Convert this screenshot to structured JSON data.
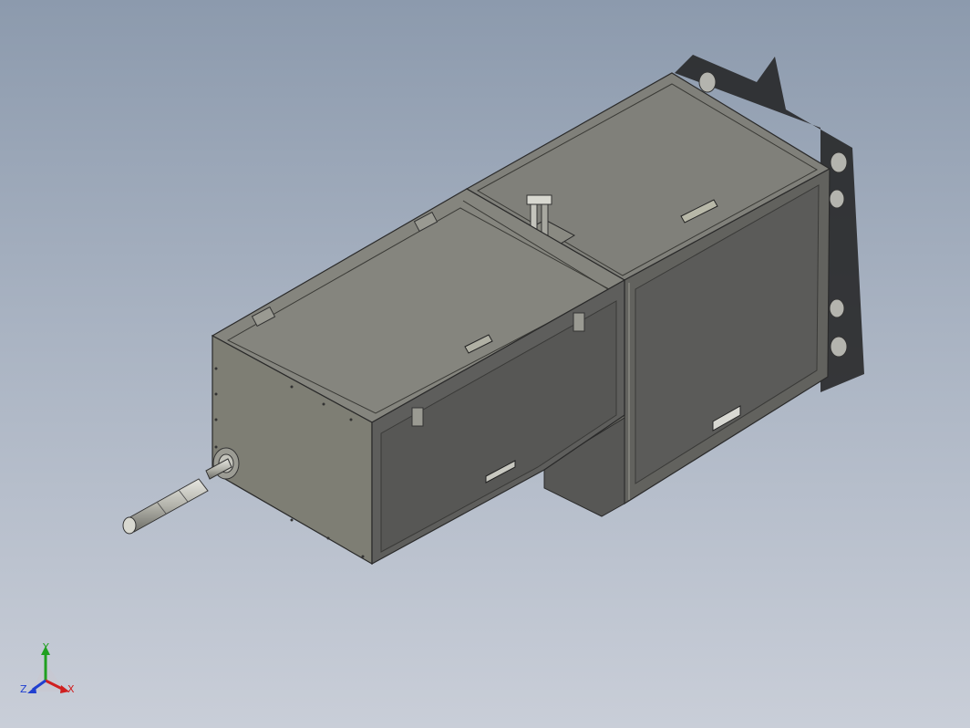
{
  "viewport": {
    "background_top": "#8c9aad",
    "background_bottom": "#c9ced8"
  },
  "model": {
    "body_color": "#7b7b74",
    "panel_color": "#5c5c5a",
    "edge_color": "#2a2a2a"
  },
  "triad": {
    "x_label": "X",
    "y_label": "Y",
    "z_label": "Z",
    "x_color": "#d02020",
    "y_color": "#20a020",
    "z_color": "#2040d0"
  }
}
